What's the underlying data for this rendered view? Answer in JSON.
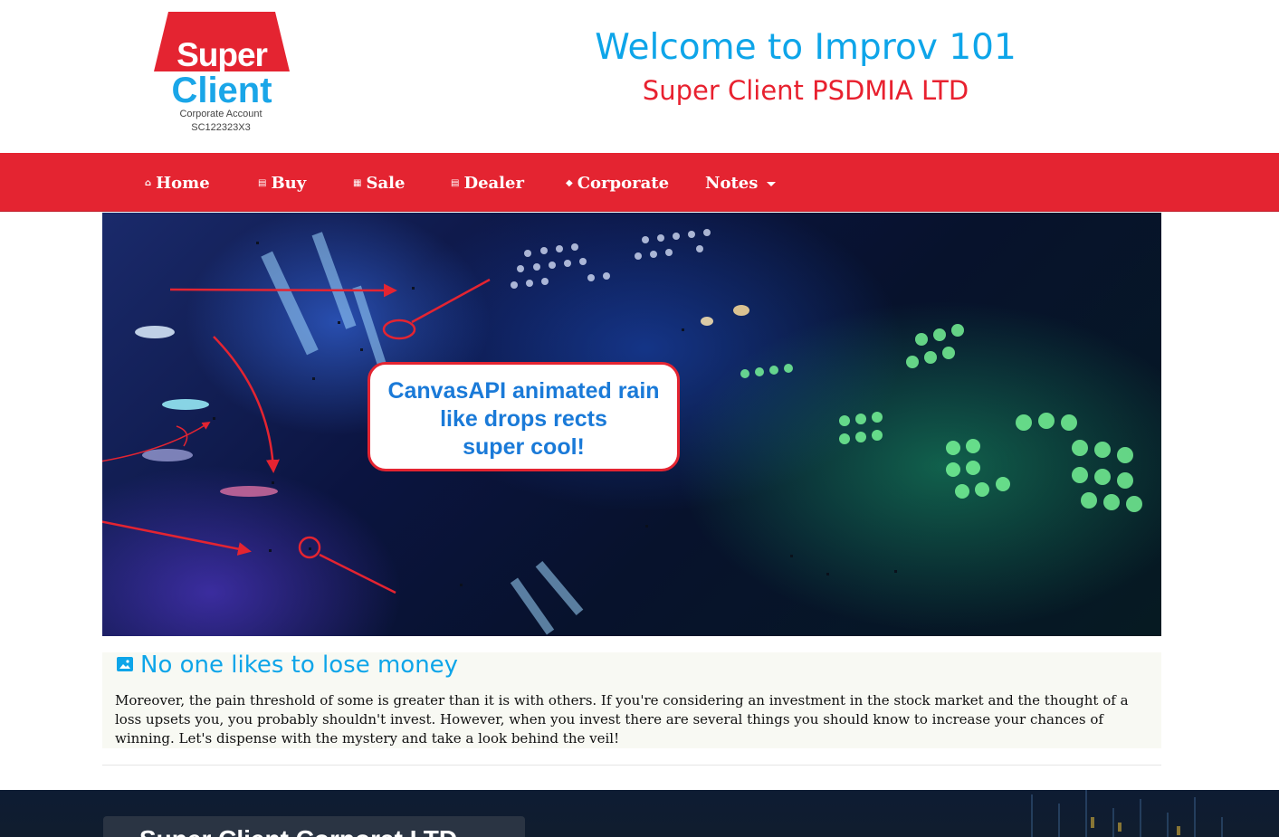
{
  "header": {
    "logo": {
      "line1": "Super",
      "line2": "Client",
      "subtitle": "Corporate Account",
      "account_id": "SC122323X3"
    },
    "welcome": "Welcome to Improv 101",
    "company": "Super Client PSDMIA LTD"
  },
  "nav": {
    "items": [
      {
        "label": "Home",
        "icon": "home-icon"
      },
      {
        "label": "Buy",
        "icon": "calendar-icon"
      },
      {
        "label": "Sale",
        "icon": "grid-icon"
      },
      {
        "label": "Dealer",
        "icon": "calendar-icon"
      },
      {
        "label": "Corporate",
        "icon": "tag-icon"
      },
      {
        "label": "Notes",
        "icon": "caret-down-icon"
      }
    ]
  },
  "banner": {
    "callout": {
      "line1": "CanvasAPI animated rain",
      "line2": "like drops rects",
      "line3": "super cool!"
    }
  },
  "article": {
    "title": "No one likes to lose money",
    "body": "Moreover, the pain threshold of some is greater than it is with others. If you're considering an investment in the stock market and the thought of a loss upsets you, you probably shouldn't invest. However, when you invest there are several things you should know to increase your chances of winning. Let's dispense with the mystery and take a look behind the veil!"
  },
  "footer": {
    "title": "Super Client Corporat LTD"
  },
  "colors": {
    "brand_red": "#e42431",
    "brand_blue": "#0ea5e9"
  }
}
